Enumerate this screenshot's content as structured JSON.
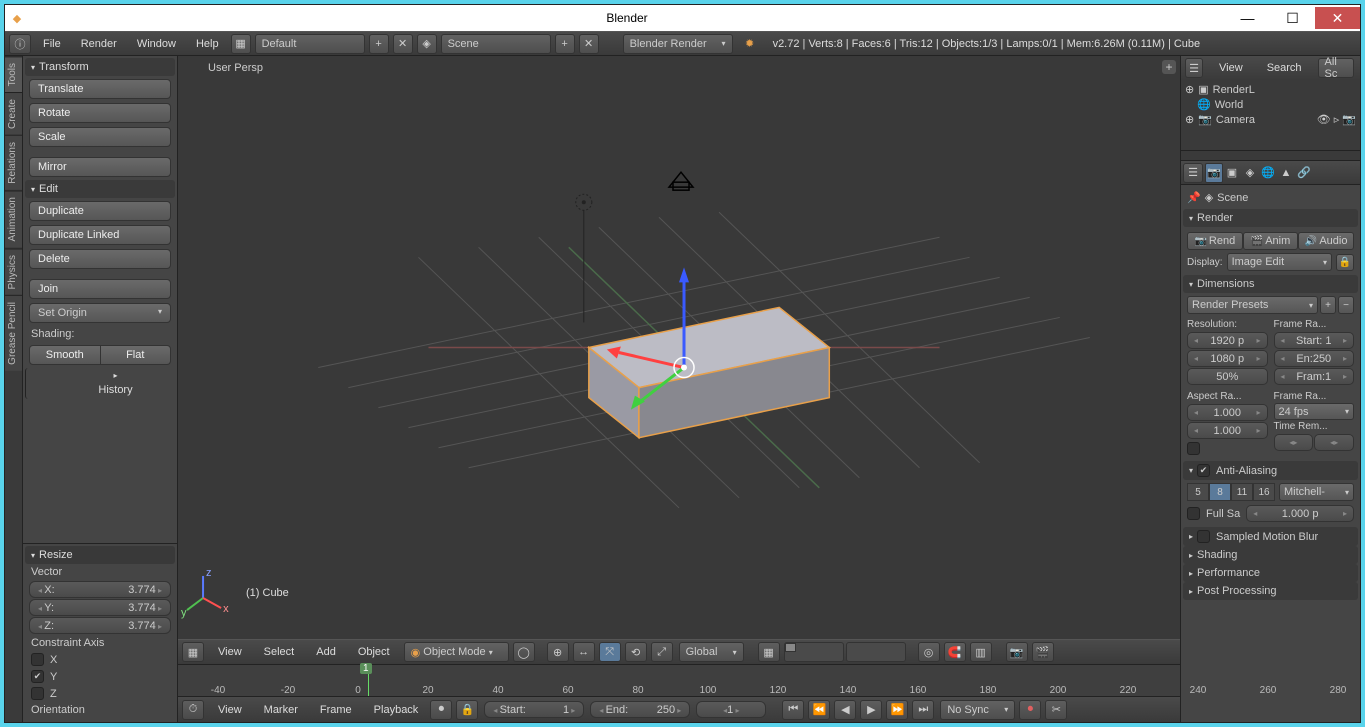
{
  "window": {
    "title": "Blender"
  },
  "menubar": {
    "items": [
      "File",
      "Render",
      "Window",
      "Help"
    ],
    "layout": "Default",
    "scene": "Scene",
    "engine": "Blender Render",
    "stats": "v2.72 | Verts:8 | Faces:6 | Tris:12 | Objects:1/3 | Lamps:0/1 | Mem:6.26M (0.11M) | Cube"
  },
  "vtabs": [
    "Tools",
    "Create",
    "Relations",
    "Animation",
    "Physics",
    "Grease Pencil"
  ],
  "tool": {
    "transform": {
      "title": "Transform",
      "translate": "Translate",
      "rotate": "Rotate",
      "scale": "Scale",
      "mirror": "Mirror"
    },
    "edit": {
      "title": "Edit",
      "dup": "Duplicate",
      "dupl": "Duplicate Linked",
      "del": "Delete",
      "join": "Join",
      "origin": "Set Origin"
    },
    "shading": {
      "label": "Shading:",
      "smooth": "Smooth",
      "flat": "Flat"
    },
    "history": "History"
  },
  "operator": {
    "title": "Resize",
    "vector": "Vector",
    "x": {
      "l": "X:",
      "v": "3.774"
    },
    "y": {
      "l": "Y:",
      "v": "3.774"
    },
    "z": {
      "l": "Z:",
      "v": "3.774"
    },
    "ca": "Constraint Axis",
    "cax": "X",
    "cay": "Y",
    "caz": "Z",
    "orient": "Orientation"
  },
  "view3d": {
    "persp": "User Persp",
    "obj": "(1) Cube",
    "header": {
      "view": "View",
      "select": "Select",
      "add": "Add",
      "object": "Object",
      "mode": "Object Mode",
      "orient": "Global"
    }
  },
  "timeline": {
    "ticks": [
      "-40",
      "-20",
      "0",
      "20",
      "40",
      "60",
      "80",
      "100",
      "120",
      "140",
      "160",
      "180",
      "200",
      "220",
      "240",
      "260",
      "280"
    ],
    "frame": "1",
    "header": {
      "view": "View",
      "marker": "Marker",
      "frame": "Frame",
      "playback": "Playback",
      "start": "Start:",
      "startv": "1",
      "end": "End:",
      "endv": "250",
      "cur": "1",
      "sync": "No Sync"
    }
  },
  "outliner": {
    "view": "View",
    "search": "Search",
    "filter": "All Sc",
    "items": [
      {
        "icon": "🎬",
        "label": "RenderL"
      },
      {
        "icon": "🌐",
        "label": "World"
      },
      {
        "icon": "📷",
        "label": "Camera"
      }
    ]
  },
  "props": {
    "crumb": "Scene",
    "render": {
      "title": "Render",
      "rend": "Rend",
      "anim": "Anim",
      "audio": "Audio",
      "display": "Display:",
      "disp_v": "Image Edit"
    },
    "dim": {
      "title": "Dimensions",
      "presets": "Render Presets",
      "res": "Resolution:",
      "x": "1920 p",
      "y": "1080 p",
      "pct": "50%",
      "fr": "Frame Ra...",
      "start": "Start: 1",
      "end": "En:250",
      "step": "Fram:1",
      "asp": "Aspect Ra...",
      "ax": "1.000",
      "ay": "1.000",
      "frate": "Frame Ra...",
      "fps": "24 fps",
      "trm": "Time Rem..."
    },
    "aa": {
      "title": "Anti-Aliasing",
      "samples": [
        "5",
        "8",
        "11",
        "16"
      ],
      "sel": "8",
      "type": "Mitchell-",
      "full": "Full Sa",
      "px": "1.000 p"
    },
    "smb": "Sampled Motion Blur",
    "shading": "Shading",
    "perf": "Performance",
    "post": "Post Processing"
  }
}
